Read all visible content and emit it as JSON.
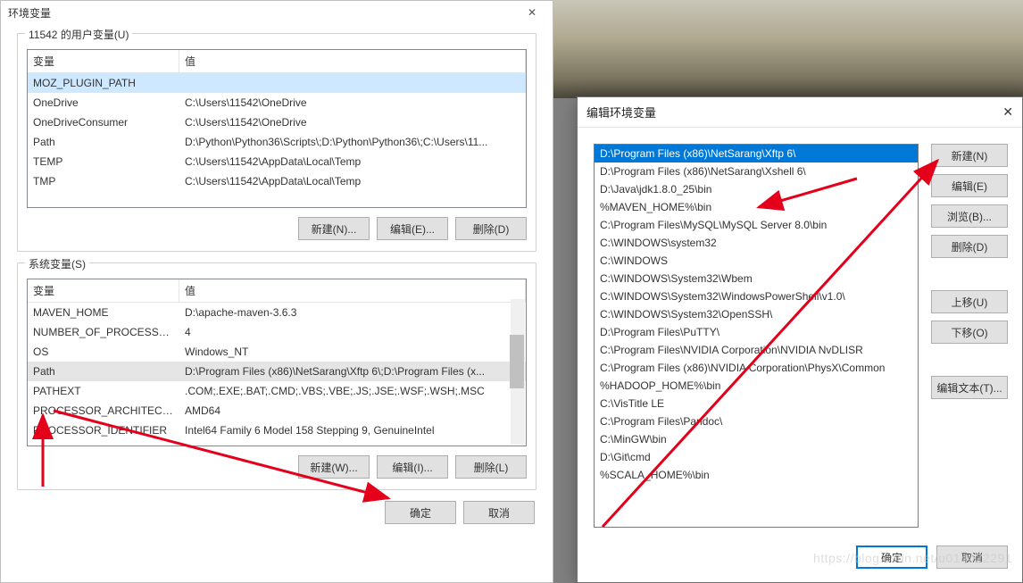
{
  "leftDialog": {
    "title": "环境变量",
    "userSection": {
      "legend": "11542 的用户变量(U)",
      "col1": "变量",
      "col2": "值",
      "rows": [
        {
          "name": "MOZ_PLUGIN_PATH",
          "value": "",
          "sel": true
        },
        {
          "name": "OneDrive",
          "value": "C:\\Users\\11542\\OneDrive"
        },
        {
          "name": "OneDriveConsumer",
          "value": "C:\\Users\\11542\\OneDrive"
        },
        {
          "name": "Path",
          "value": "D:\\Python\\Python36\\Scripts\\;D:\\Python\\Python36\\;C:\\Users\\11..."
        },
        {
          "name": "TEMP",
          "value": "C:\\Users\\11542\\AppData\\Local\\Temp"
        },
        {
          "name": "TMP",
          "value": "C:\\Users\\11542\\AppData\\Local\\Temp"
        }
      ],
      "btnNew": "新建(N)...",
      "btnEdit": "编辑(E)...",
      "btnDelete": "删除(D)"
    },
    "sysSection": {
      "legend": "系统变量(S)",
      "col1": "变量",
      "col2": "值",
      "rows": [
        {
          "name": "MAVEN_HOME",
          "value": "D:\\apache-maven-3.6.3"
        },
        {
          "name": "NUMBER_OF_PROCESSORS",
          "value": "4"
        },
        {
          "name": "OS",
          "value": "Windows_NT"
        },
        {
          "name": "Path",
          "value": "D:\\Program Files (x86)\\NetSarang\\Xftp 6\\;D:\\Program Files (x...",
          "sel": true
        },
        {
          "name": "PATHEXT",
          "value": ".COM;.EXE;.BAT;.CMD;.VBS;.VBE;.JS;.JSE;.WSF;.WSH;.MSC"
        },
        {
          "name": "PROCESSOR_ARCHITECTURE",
          "value": "AMD64"
        },
        {
          "name": "PROCESSOR_IDENTIFIER",
          "value": "Intel64 Family 6 Model 158 Stepping 9, GenuineIntel"
        }
      ],
      "btnNew": "新建(W)...",
      "btnEdit": "编辑(I)...",
      "btnDelete": "删除(L)"
    },
    "btnOk": "确定",
    "btnCancel": "取消"
  },
  "rightDialog": {
    "title": "编辑环境变量",
    "items": [
      {
        "text": "D:\\Program Files (x86)\\NetSarang\\Xftp 6\\",
        "sel": true
      },
      {
        "text": "D:\\Program Files (x86)\\NetSarang\\Xshell 6\\"
      },
      {
        "text": "D:\\Java\\jdk1.8.0_25\\bin"
      },
      {
        "text": "%MAVEN_HOME%\\bin"
      },
      {
        "text": "C:\\Program Files\\MySQL\\MySQL Server 8.0\\bin"
      },
      {
        "text": "C:\\WINDOWS\\system32"
      },
      {
        "text": "C:\\WINDOWS"
      },
      {
        "text": "C:\\WINDOWS\\System32\\Wbem"
      },
      {
        "text": "C:\\WINDOWS\\System32\\WindowsPowerShell\\v1.0\\"
      },
      {
        "text": "C:\\WINDOWS\\System32\\OpenSSH\\"
      },
      {
        "text": "D:\\Program Files\\PuTTY\\"
      },
      {
        "text": "C:\\Program Files\\NVIDIA Corporation\\NVIDIA NvDLISR"
      },
      {
        "text": "C:\\Program Files (x86)\\NVIDIA Corporation\\PhysX\\Common"
      },
      {
        "text": "%HADOOP_HOME%\\bin"
      },
      {
        "text": "C:\\VisTitle LE"
      },
      {
        "text": "C:\\Program Files\\Pandoc\\"
      },
      {
        "text": "C:\\MinGW\\bin"
      },
      {
        "text": "D:\\Git\\cmd"
      },
      {
        "text": "%SCALA_HOME%\\bin"
      }
    ],
    "btnNew": "新建(N)",
    "btnEdit": "编辑(E)",
    "btnBrowse": "浏览(B)...",
    "btnDelete": "删除(D)",
    "btnUp": "上移(U)",
    "btnDown": "下移(O)",
    "btnEditText": "编辑文本(T)...",
    "btnOk": "确定",
    "btnCancel": "取消"
  },
  "watermark": "https://blog.csdn.net/u014022291"
}
